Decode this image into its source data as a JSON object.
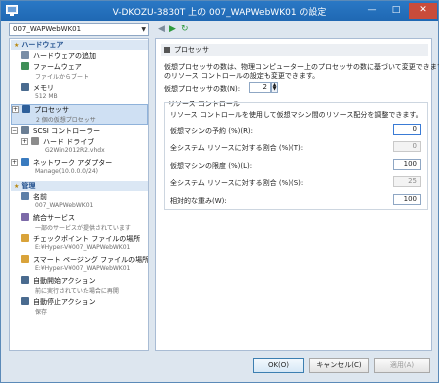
{
  "window": {
    "title": "V-DKOZU-3830T 上の 007_WAPWebWK01 の設定",
    "controls": {
      "minimize": "—",
      "maximize": "□",
      "close": "✕"
    }
  },
  "toolbar": {
    "vm_name": "007_WAPWebWK01"
  },
  "sidebar": {
    "hardware_header": "ハードウェア",
    "management_header": "管理",
    "hardware": [
      {
        "label": "ハードウェアの追加",
        "sub": ""
      },
      {
        "label": "ファームウェア",
        "sub": "ファイルからブート"
      },
      {
        "label": "メモリ",
        "sub": "512 MB"
      },
      {
        "label": "プロセッサ",
        "sub": "2 個の仮想プロセッサ"
      },
      {
        "label": "SCSI コントローラー",
        "sub": ""
      },
      {
        "label": "ハード ドライブ",
        "sub": "G2Win2012R2.vhdx"
      },
      {
        "label": "ネットワーク アダプター",
        "sub": "Manage(10.0.0.0/24)"
      }
    ],
    "management": [
      {
        "label": "名前",
        "sub": "007_WAPWebWK01"
      },
      {
        "label": "統合サービス",
        "sub": "一部のサービスが提供されています"
      },
      {
        "label": "チェックポイント ファイルの場所",
        "sub": "E:¥Hyper-V¥007_WAPWebWK01"
      },
      {
        "label": "スマート ページング ファイルの場所",
        "sub": "E:¥Hyper-V¥007_WAPWebWK01"
      },
      {
        "label": "自動開始アクション",
        "sub": "前に実行されていた場合に再開"
      },
      {
        "label": "自動停止アクション",
        "sub": "保存"
      }
    ]
  },
  "processor": {
    "section_title": "プロセッサ",
    "description_line1": "仮想プロセッサの数は、物理コンピューター上のプロセッサの数に基づいて変更できます。他",
    "description_line2": "のリソース コントロールの設定も変更できます。",
    "count_label": "仮想プロセッサの数(N):",
    "count_value": "2",
    "resource_control": {
      "group_title": "リソース コントロール",
      "description": "リソース コントロールを使用して仮想マシン間のリソース配分を調整できます。",
      "reserve_label": "仮想マシンの予約 (%)(R):",
      "reserve_value": "0",
      "reserve_total_label": "全システム リソースに対する割合 (%)(T):",
      "reserve_total_value": "0",
      "limit_label": "仮想マシンの限度 (%)(L):",
      "limit_value": "100",
      "limit_total_label": "全システム リソースに対する割合 (%)(S):",
      "limit_total_value": "25",
      "weight_label": "相対的な重み(W):",
      "weight_value": "100"
    }
  },
  "buttons": {
    "ok": "OK(O)",
    "cancel": "キャンセル(C)",
    "apply": "適用(A)"
  },
  "colors": {
    "titlebar": "#1f68b3",
    "accent": "#2e9a3e",
    "selection": "#cfe0f3"
  }
}
